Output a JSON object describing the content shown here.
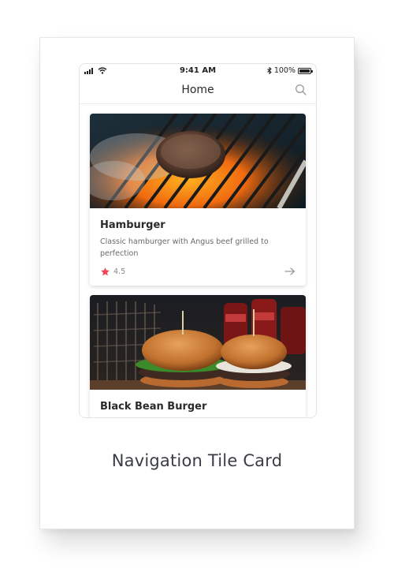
{
  "status_bar": {
    "time": "9:41 AM",
    "battery_text": "100%",
    "battery_level": 1.0
  },
  "nav": {
    "title": "Home",
    "search_icon": "search-icon"
  },
  "tiles": [
    {
      "title": "Hamburger",
      "description": "Classic hamburger with Angus beef grilled to perfection",
      "rating": "4.5",
      "rating_icon": "star-icon",
      "action_icon": "arrow-right-icon",
      "image": "grilled-patty-photo"
    },
    {
      "title": "Black Bean Burger",
      "image": "black-bean-burger-photo"
    }
  ],
  "caption": "Navigation Tile Card",
  "colors": {
    "accent_star": "#f0455a",
    "text_primary": "#2a2a2a",
    "text_secondary": "#6a6a6a",
    "caption": "#3a3d45"
  }
}
